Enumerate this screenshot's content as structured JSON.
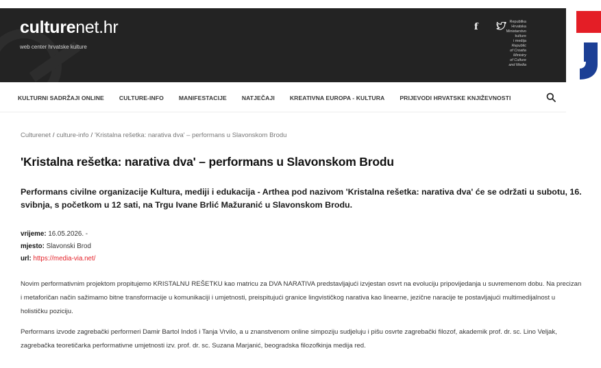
{
  "header": {
    "logo_bold": "culture",
    "logo_light": "net.hr",
    "tagline": "web center hrvatske kulture",
    "social": {
      "facebook_glyph": "f",
      "twitter_glyph": "ᵥ"
    },
    "ministry_lines": [
      "Republika",
      "Hrvatska",
      "Ministarstvo",
      "kulture",
      "i medija"
    ],
    "ministry_lines_en": [
      "Republic",
      "of Croatia",
      "Ministry",
      "of Culture",
      "and Media"
    ]
  },
  "colors": {
    "accent_red": "#e41e26",
    "header_bg": "#232323",
    "hook_blue": "#1c3f95"
  },
  "nav": {
    "items": [
      "KULTURNI SADRŽAJI ONLINE",
      "CULTURE-INFO",
      "MANIFESTACIJE",
      "NATJEČAJI",
      "KREATIVNA EUROPA - KULTURA",
      "PRIJEVODI HRVATSKE KNJIŽEVNOSTI"
    ],
    "search_icon": "search-icon"
  },
  "breadcrumb": {
    "items": [
      "Culturenet",
      "culture-info",
      "'Kristalna rešetka: narativa dva' – performans u Slavonskom Brodu"
    ],
    "separator": "/"
  },
  "article": {
    "title": "'Kristalna rešetka: narativa dva' – performans u Slavonskom Brodu",
    "lead": "Performans civilne organizacije Kultura, mediji i edukacija - Arthea pod nazivom 'Kristalna rešetka: narativa dva' će se održati u subotu, 16. svibnja, s početkom u 12 sati, na Trgu Ivane Brlić Mažuranić u Slavonskom Brodu.",
    "meta": {
      "time_label": "vrijeme:",
      "time_value": "16.05.2026. -",
      "place_label": "mjesto:",
      "place_value": "Slavonski Brod",
      "url_label": "url:",
      "url_value": "https://media-via.net/"
    },
    "para1": "Novim performativnim projektom propitujemo KRISTALNU REŠETKU kao matricu za DVA NARATIVA predstavljajući izvjestan osvrt na evoluciju pripovijedanja u suvremenom dobu. Na precizan i metaforičan način sažimamo bitne transformacije u komunikaciji i umjetnosti, preispitujući granice lingvističkog narativa kao linearne, jezične naracije te postavljajući multimedijalnost u holističku poziciju.",
    "para2": "Performans izvode zagrebački performeri Damir Bartol Indoš i Tanja Vrvilo, a u znanstvenom online simpoziju sudjeluju i pišu osvrte zagrebački filozof, akademik prof. dr. sc. Lino Veljak, zagrebačka teoretičarka performativne umjetnosti izv. prof. dr. sc. Suzana Marjanić, beogradska filozofkinja medija red."
  }
}
